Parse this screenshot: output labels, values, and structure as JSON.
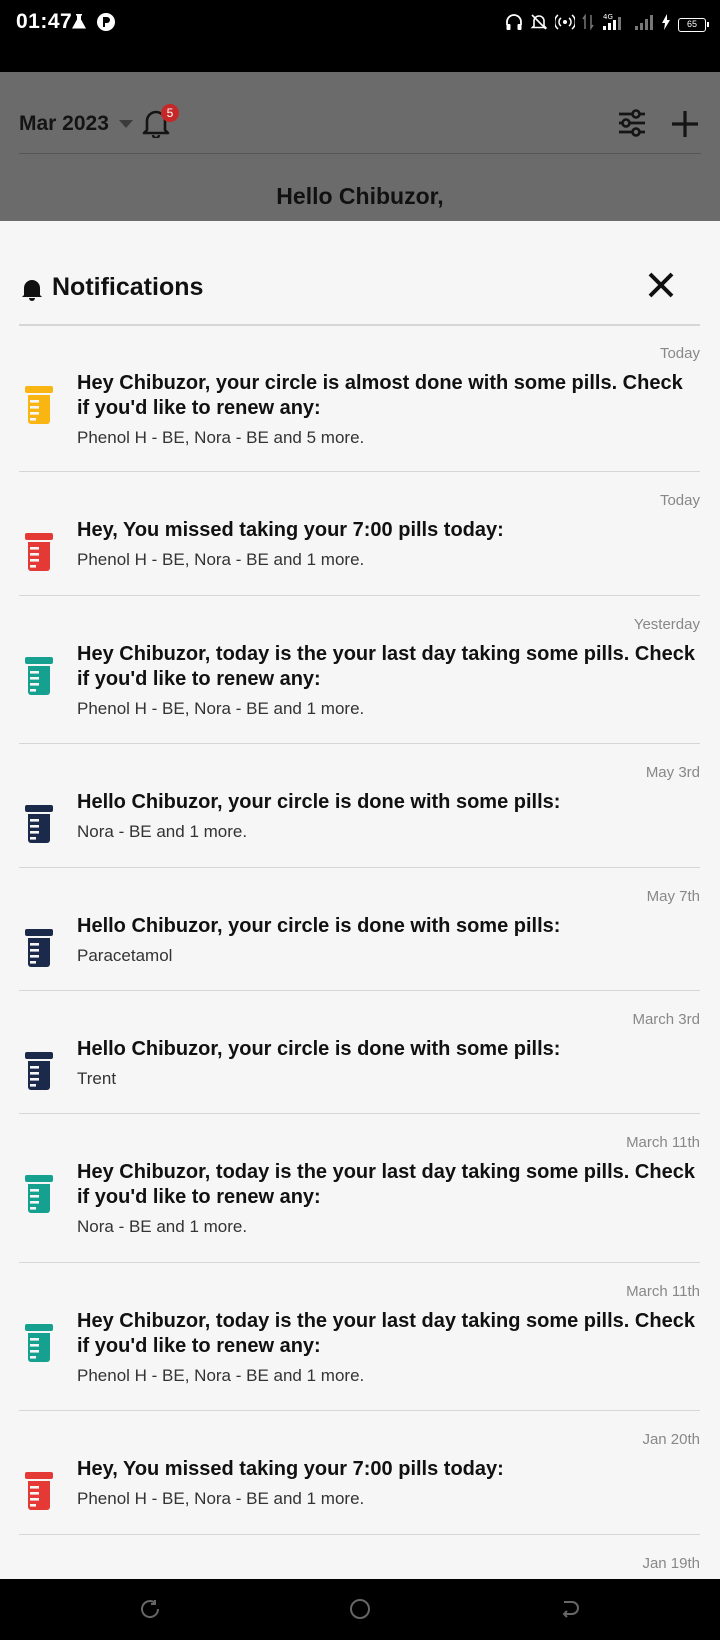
{
  "status_bar": {
    "time": "01:47",
    "battery": "65",
    "network": "4G"
  },
  "header": {
    "month_label": "Mar 2023",
    "notification_count": "5",
    "greeting": "Hello Chibuzor,"
  },
  "sheet": {
    "title": "Notifications",
    "items": [
      {
        "date": "Today",
        "icon_color": "#F9B512",
        "title": "Hey Chibuzor, your circle is almost done with some pills. Check if you'd like to renew any:",
        "subtitle": "Phenol H - BE, Nora - BE and 5 more."
      },
      {
        "date": "Today",
        "icon_color": "#E53935",
        "title": "Hey, You missed taking your 7:00 pills today:",
        "subtitle": "Phenol H - BE, Nora - BE and 1 more."
      },
      {
        "date": "Yesterday",
        "icon_color": "#16A090",
        "title": "Hey Chibuzor, today is the your last day taking some pills. Check if you'd like to renew any:",
        "subtitle": "Phenol H - BE, Nora - BE and 1 more."
      },
      {
        "date": "May 3rd",
        "icon_color": "#1B2A4A",
        "title": "Hello Chibuzor, your circle is done with some pills:",
        "subtitle": "Nora - BE and 1 more."
      },
      {
        "date": "May 7th",
        "icon_color": "#1B2A4A",
        "title": "Hello Chibuzor, your circle is done with some pills:",
        "subtitle": "Paracetamol"
      },
      {
        "date": "March 3rd",
        "icon_color": "#1B2A4A",
        "title": "Hello Chibuzor, your circle is done with some pills:",
        "subtitle": "Trent"
      },
      {
        "date": "March 11th",
        "icon_color": "#16A090",
        "title": "Hey Chibuzor, today is the your last day taking some pills. Check if you'd like to renew any:",
        "subtitle": "Nora - BE and 1 more."
      },
      {
        "date": "March 11th",
        "icon_color": "#16A090",
        "title": "Hey Chibuzor, today is the your last day taking some pills. Check if you'd like to renew any:",
        "subtitle": "Phenol H - BE, Nora - BE and 1 more."
      },
      {
        "date": "Jan 20th",
        "icon_color": "#E53935",
        "title": "Hey, You missed taking your 7:00 pills today:",
        "subtitle": "Phenol H - BE, Nora - BE and 1 more."
      },
      {
        "date": "Jan 19th",
        "icon_color": "#16A090",
        "title": "",
        "subtitle": ""
      }
    ]
  }
}
